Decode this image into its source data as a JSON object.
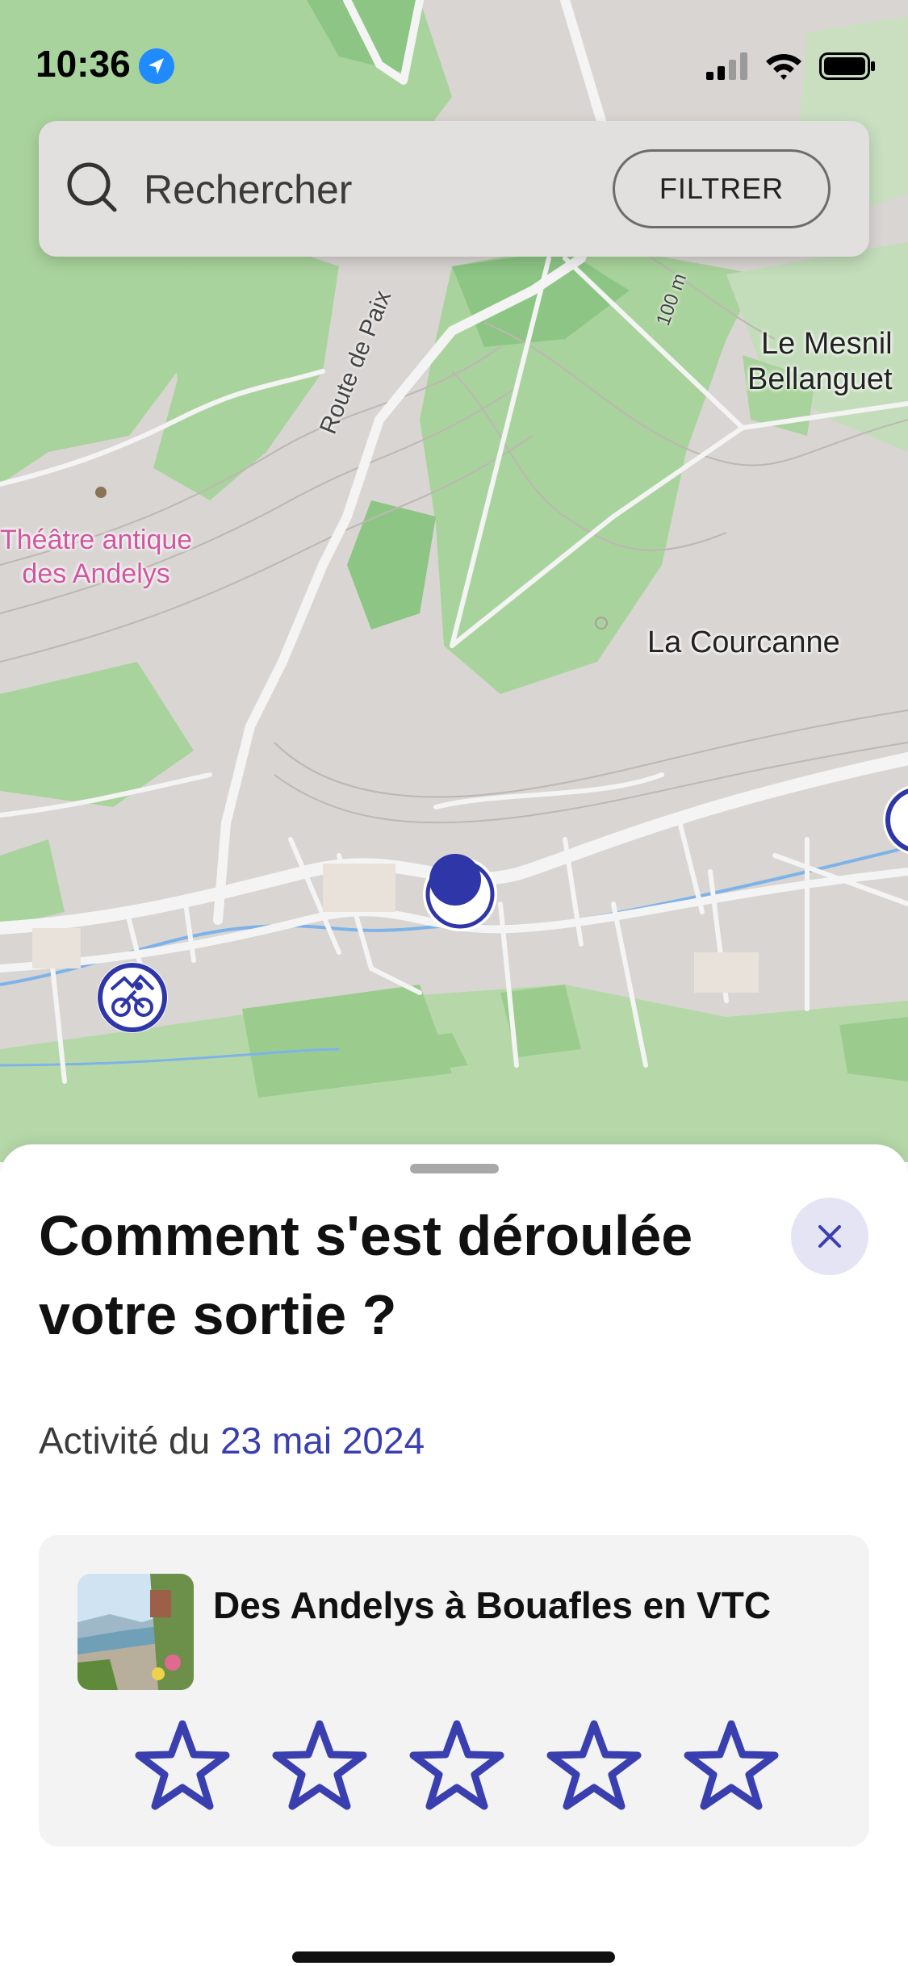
{
  "status_bar": {
    "time": "10:36",
    "icons": [
      "location-arrow-icon",
      "signal-icon",
      "wifi-icon",
      "battery-icon"
    ]
  },
  "search": {
    "placeholder": "Rechercher",
    "filter_label": "FILTRER"
  },
  "map": {
    "labels": {
      "mesnil": "Le Mesnil\nBellanguet",
      "theatre": "Théâtre antique\ndes Andelys",
      "courcanne": "La Courcanne",
      "route": "Route de Paix",
      "contour": "100 m"
    },
    "colors": {
      "forest": "#a9d39c",
      "forest_dark": "#8dc585",
      "land": "#d9d5d3",
      "road": "#f4f4f4",
      "water": "#7db3e8",
      "marker": "#2e36a8"
    }
  },
  "sheet": {
    "title": "Comment s'est déroulée votre sortie ?",
    "activity_prefix": "Activité du",
    "activity_date": "23 mai 2024",
    "card": {
      "title": "Des Andelys à Bouafles en VTC",
      "rating": 0,
      "max_rating": 5
    },
    "accent_color": "#3a3fb0"
  }
}
